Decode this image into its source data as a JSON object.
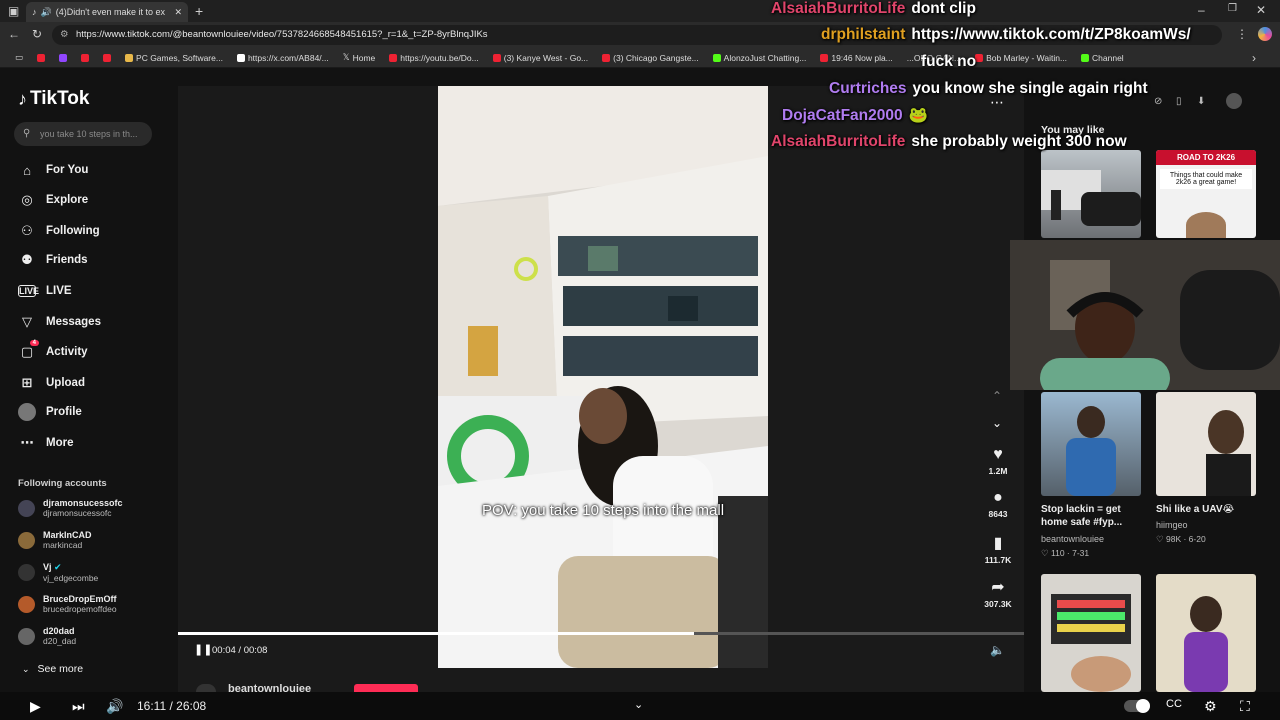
{
  "browser": {
    "tab_title": "(4)Didn't even make it to ex",
    "url": "https://www.tiktok.com/@beantownlouiee/video/7537824668548451615?_r=1&_t=ZP-8yrBlnqJIKs",
    "bookmarks": [
      "PC Games, Software...",
      "https://x.com/AB84/...",
      "Home",
      "https://youtu.be/Do...",
      "(3) Kanye West - Go...",
      "(3) Chicago Gangste...",
      "AlonzoJust Chatting...",
      "19:46 Now pla...",
      "...ORO GAN...",
      "Bob Marley - Waitin...",
      "Channel"
    ]
  },
  "tiktok": {
    "logo": "TikTok",
    "search_placeholder": "you take 10 steps in th...",
    "nav": [
      "For You",
      "Explore",
      "Following",
      "Friends",
      "LIVE",
      "Messages",
      "Activity",
      "Upload",
      "Profile",
      "More"
    ],
    "activity_badge": "4",
    "following_title": "Following accounts",
    "accounts": [
      {
        "name": "djramonsucessofc",
        "handle": "djramonsucessofc"
      },
      {
        "name": "MarkInCAD",
        "handle": "markincad"
      },
      {
        "name": "Vj",
        "handle": "vj_edgecombe"
      },
      {
        "name": "BruceDropEmOff",
        "handle": "brucedropemoffdeo"
      },
      {
        "name": "d20dad",
        "handle": "d20_dad"
      }
    ],
    "see_more": "See more",
    "video": {
      "caption": "POV: you take 10 steps into the mall",
      "time": "00:04 / 00:08",
      "progress": 0.61,
      "likes": "1.2M",
      "comments": "8643",
      "saves": "111.7K",
      "shares": "307.3K",
      "author_partial": "beantownlouiee"
    },
    "right": {
      "heading": "You may like",
      "cards": [
        {
          "title": "Stop lackin = get home safe #fyp...",
          "user": "beantownlouiee",
          "stat": "110 · 7-31"
        },
        {
          "title": "Shi like a UAV😭",
          "user": "hiimgeo",
          "stat": "98K · 6-20"
        }
      ],
      "thumb_text": "Things that could make 2k26 a great game!",
      "thumb_badge": "ROAD TO 2K26"
    }
  },
  "chat": [
    {
      "user": "AlsaiahBurritoLife",
      "msg": "dont clip",
      "color": "#e0456b"
    },
    {
      "user": "drphilstaint",
      "msg": "https://www.tiktok.com/t/ZP8koamWs/",
      "color": "#e0a020"
    },
    {
      "user": "",
      "msg": "fuck no",
      "color": "#e04545"
    },
    {
      "user": "Curtriches",
      "msg": "you know she single again right",
      "color": "#b07cf0"
    },
    {
      "user": "DojaCatFan2000",
      "msg": "🐸",
      "color": "#b07cf0"
    },
    {
      "user": "AlsaiahBurritoLife",
      "msg": "she probably weight 300 now",
      "color": "#e0456b"
    }
  ],
  "youtube": {
    "time": "16:11 / 26:08"
  }
}
